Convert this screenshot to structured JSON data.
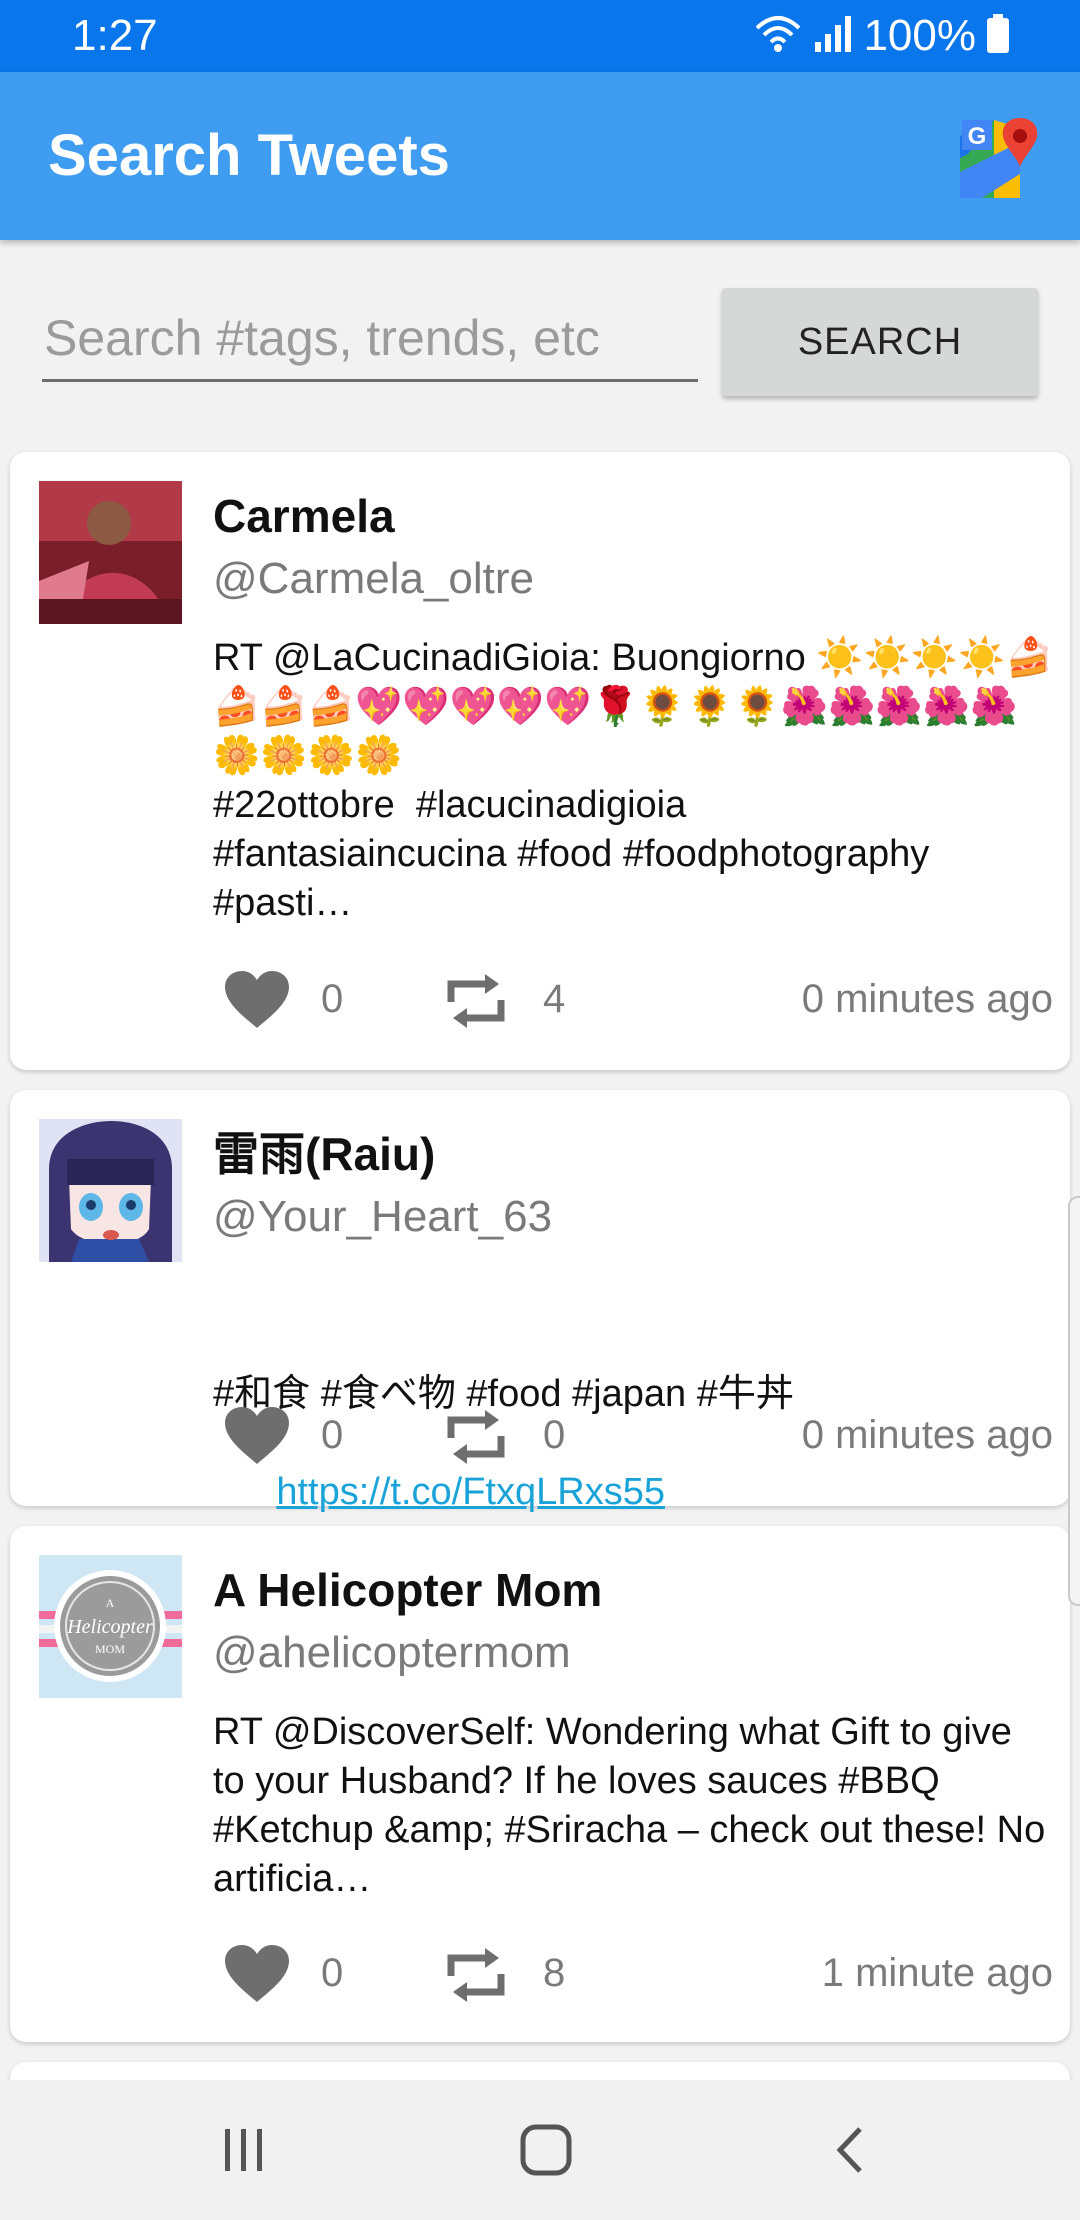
{
  "status_bar": {
    "time": "1:27",
    "battery": "100%"
  },
  "app_bar": {
    "title": "Search Tweets",
    "maps_icon": "google-maps-icon"
  },
  "search": {
    "placeholder": "Search #tags, trends, etc",
    "value": "",
    "button_label": "SEARCH"
  },
  "tweets": [
    {
      "name": "Carmela",
      "handle": "@Carmela_oltre",
      "text": "RT @LaCucinadiGioia: Buongiorno ☀️☀️☀️☀️🍰🍰🍰🍰💖💖💖💖💖🌹🌻🌻🌻🌺🌺🌺🌺🌺🌼🌼🌼🌼\n#22ottobre  #lacucinadigioia\n#fantasiaincucina #food #foodphotography\n#pasti…",
      "likes": "0",
      "retweets": "4",
      "time": "0 minutes ago"
    },
    {
      "name": "雷雨(Raiu)",
      "handle": "@Your_Heart_63",
      "text": "#和食 #食べ物 #food #japan #牛丼",
      "link": "https://t.co/FtxqLRxs55",
      "likes": "0",
      "retweets": "0",
      "time": "0 minutes ago"
    },
    {
      "name": "A Helicopter Mom",
      "handle": "@ahelicoptermom",
      "text": "RT @DiscoverSelf: Wondering what Gift to give to your Husband? If he loves sauces #BBQ #Ketchup &amp; #Sriracha – check out these! No artificia…",
      "avatar_text_lines": [
        "A",
        "Helicopter",
        "MOM"
      ],
      "likes": "0",
      "retweets": "8",
      "time": "1 minute ago"
    }
  ],
  "icons": {
    "like": "heart-icon",
    "retweet": "retweet-icon",
    "nav_recents": "recents-icon",
    "nav_home": "home-icon",
    "nav_back": "back-icon"
  },
  "colors": {
    "status_bar": "#0a76ec",
    "app_bar": "#3f9cf0",
    "link": "#1aa3d9",
    "icon_gray": "#6e6e6e"
  }
}
